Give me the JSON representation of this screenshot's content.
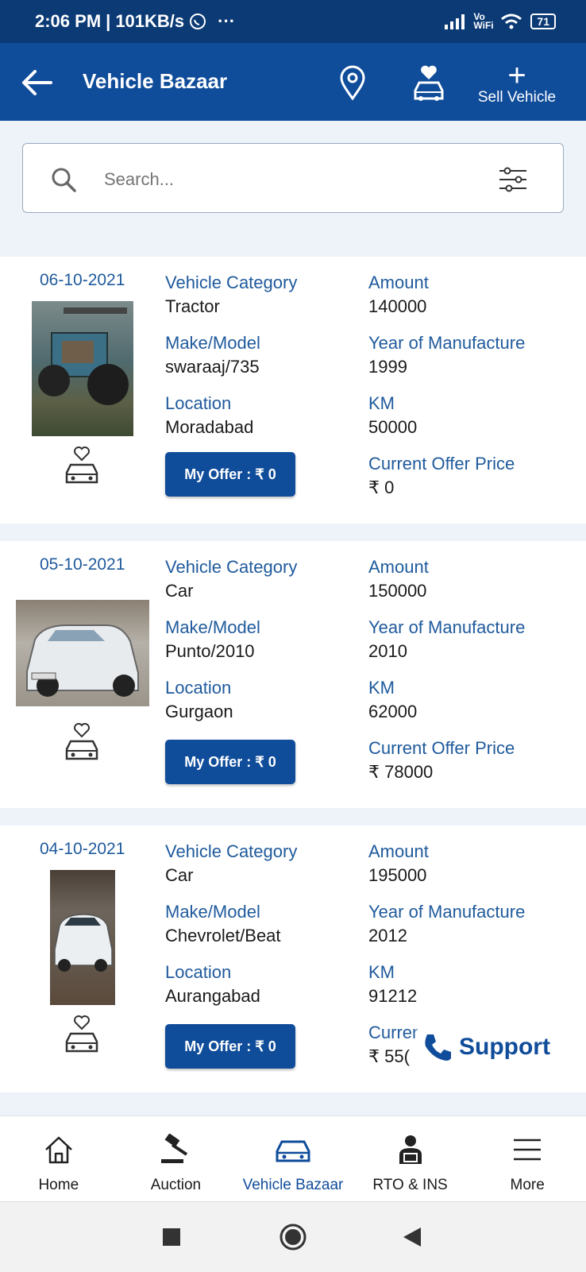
{
  "status_bar": {
    "time": "2:06 PM",
    "speed": "101KB/s",
    "extra": "···",
    "network": "Vo WiFi",
    "battery": "71"
  },
  "app_bar": {
    "title": "Vehicle Bazaar",
    "sell_label": "Sell Vehicle"
  },
  "search": {
    "placeholder": "Search..."
  },
  "labels": {
    "category": "Vehicle Category",
    "make_model": "Make/Model",
    "location": "Location",
    "amount": "Amount",
    "year": "Year of Manufacture",
    "km": "KM",
    "current_offer": "Current Offer Price"
  },
  "listings": [
    {
      "date": "06-10-2021",
      "category": "Tractor",
      "make_model": "swaraaj/735",
      "location": "Moradabad",
      "amount": "140000",
      "year": "1999",
      "km": "50000",
      "current_offer": "₹ 0",
      "my_offer": "My Offer : ₹ 0"
    },
    {
      "date": "05-10-2021",
      "category": "Car",
      "make_model": "Punto/2010",
      "location": "Gurgaon",
      "amount": "150000",
      "year": "2010",
      "km": "62000",
      "current_offer": "₹ 78000",
      "my_offer": "My Offer : ₹ 0"
    },
    {
      "date": "04-10-2021",
      "category": "Car",
      "make_model": "Chevrolet/Beat",
      "location": "Aurangabad",
      "amount": "195000",
      "year": "2012",
      "km": "91212",
      "current_offer": "₹ 55(",
      "my_offer": "My Offer : ₹ 0"
    }
  ],
  "support_label": "Support",
  "bottom_nav": [
    {
      "label": "Home",
      "icon": "home-icon"
    },
    {
      "label": "Auction",
      "icon": "gavel-icon"
    },
    {
      "label": "Vehicle Bazaar",
      "icon": "car-icon"
    },
    {
      "label": "RTO & INS",
      "icon": "agent-icon"
    },
    {
      "label": "More",
      "icon": "menu-icon"
    }
  ],
  "colors": {
    "primary": "#0f4c9a",
    "status_bar": "#0b3a75",
    "label_blue": "#1f5a9c"
  }
}
